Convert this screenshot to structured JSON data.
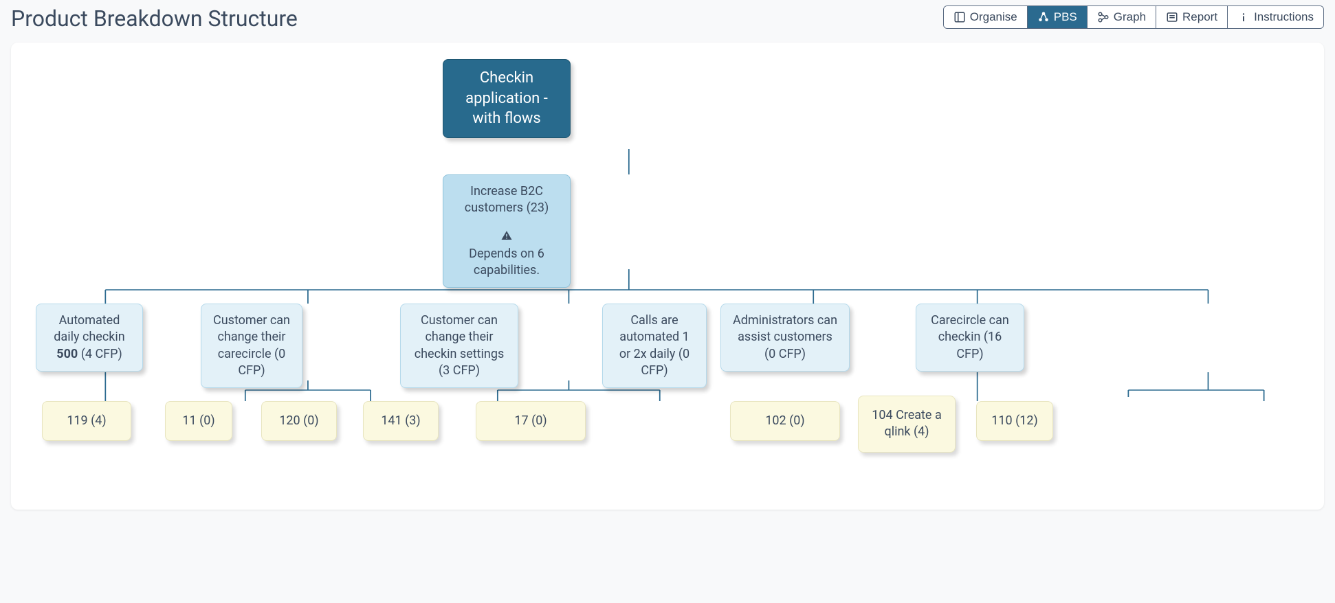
{
  "title": "Product Breakdown Structure",
  "toolbar": {
    "organise": "Organise",
    "pbs": "PBS",
    "graph": "Graph",
    "report": "Report",
    "instructions": "Instructions"
  },
  "tree": {
    "root": {
      "line1": "Checkin",
      "line2": "application -",
      "line3": "with flows"
    },
    "sub": {
      "title": "Increase B2C customers (23)",
      "warning": "Depends on 6 capabilities."
    },
    "caps": [
      {
        "pre": "Automated daily checkin ",
        "bold": "500",
        "post": " (4 CFP)"
      },
      {
        "text": "Customer can change their carecircle (0 CFP)"
      },
      {
        "text": "Customer can change their checkin settings (3 CFP)"
      },
      {
        "text": "Calls are automated 1 or 2x daily (0 CFP)"
      },
      {
        "text": "Administrators can assist customers (0 CFP)"
      },
      {
        "text": "Carecircle can checkin (16 CFP)"
      }
    ],
    "leaves": {
      "l0": "119 (4)",
      "l1a": "11 (0)",
      "l1b": "120 (0)",
      "l2a": "141 (3)",
      "l2b": "17 (0)",
      "l4": "102 (0)",
      "l5a": "104 Create a qlink (4)",
      "l5b": "110 (12)"
    }
  }
}
